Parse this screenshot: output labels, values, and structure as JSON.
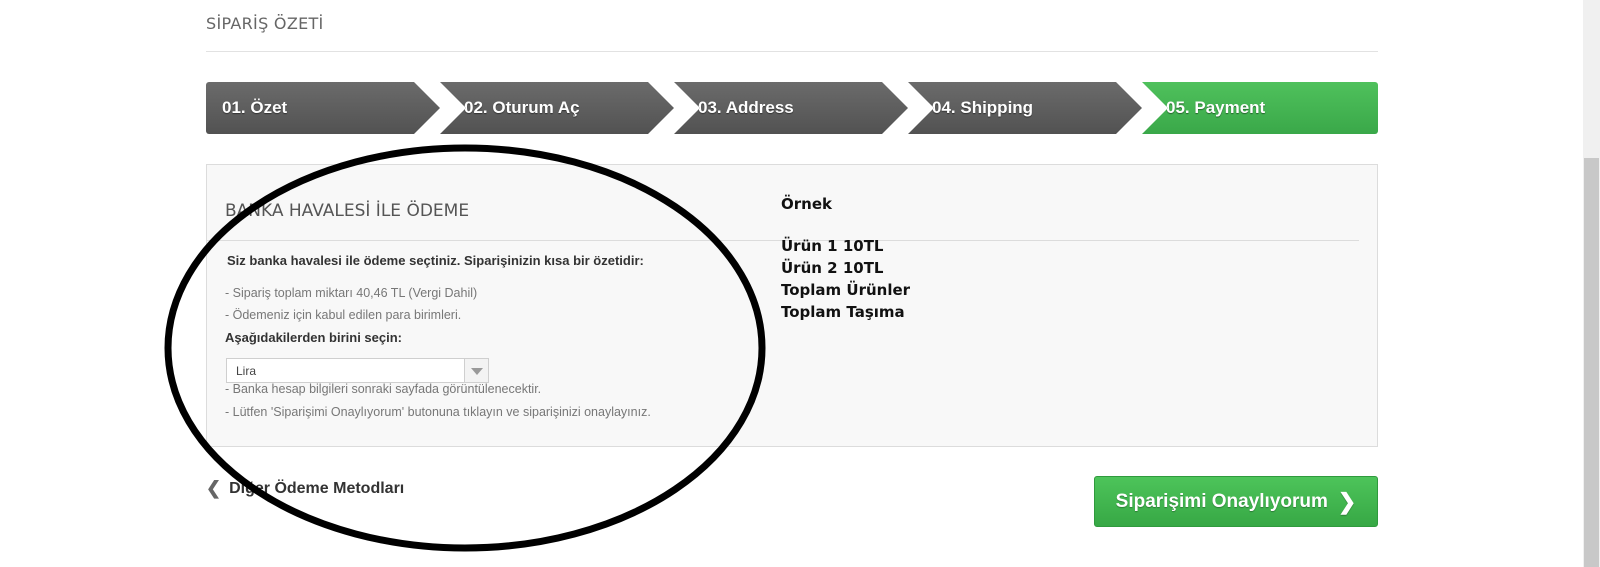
{
  "page_title": "SİPARİŞ ÖZETİ",
  "steps": [
    {
      "label": "01. Özet"
    },
    {
      "label": "02. Oturum Aç"
    },
    {
      "label": "03. Address"
    },
    {
      "label": "04. Shipping"
    },
    {
      "label": "05. Payment"
    }
  ],
  "payment": {
    "heading": "BANKA HAVALESİ İLE ÖDEME",
    "intro": "Siz banka havalesi ile ödeme seçtiniz. Siparişinizin kısa bir özetidir:",
    "line1": "- Sipariş toplam miktarı 40,46 TL (Vergi Dahil)",
    "line2": "- Ödemeniz için kabul edilen para birimleri.",
    "choose_label": "Aşağıdakilerden birini seçin:",
    "currency_selected": "Lira",
    "line3": "- Banka hesap bilgileri sonraki sayfada görüntülenecektir.",
    "line4": "- Lütfen 'Siparişimi Onaylıyorum' butonuna tıklayın ve siparişinizi onaylayınız."
  },
  "summary": {
    "title": "Örnek",
    "item1": "Ürün 1 10TL",
    "item2": "Ürün 2 10TL",
    "total_products": "Toplam Ürünler",
    "total_shipping": "Toplam Taşıma"
  },
  "actions": {
    "back_label": "Diğer Ödeme Metodları",
    "confirm_label": "Siparişimi Onaylıyorum"
  },
  "colors": {
    "step_active": "#3fb14f",
    "step_inactive": "#5e5e5e",
    "confirm_button": "#3fb14f"
  }
}
